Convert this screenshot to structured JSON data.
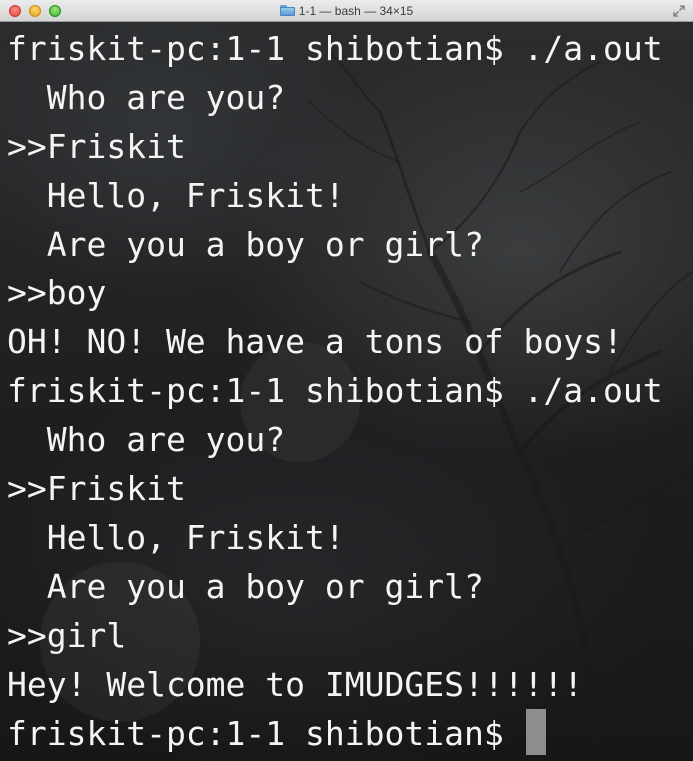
{
  "window": {
    "title": "1-1 — bash — 34×15",
    "folder_icon": "folder-icon",
    "resize_icon": "fullscreen-arrows-icon"
  },
  "terminal": {
    "lines": [
      "friskit-pc:1-1 shibotian$ ./a.out",
      "  Who are you?",
      ">>Friskit",
      "  Hello, Friskit!",
      "  Are you a boy or girl?",
      ">>boy",
      "OH! NO! We have a tons of boys!",
      "friskit-pc:1-1 shibotian$ ./a.out",
      "  Who are you?",
      ">>Friskit",
      "  Hello, Friskit!",
      "  Are you a boy or girl?",
      ">>girl",
      "Hey! Welcome to IMUDGES!!!!!!",
      "friskit-pc:1-1 shibotian$ "
    ],
    "text_color": "#f4f4f4",
    "cursor_color": "#8d8d8d"
  }
}
